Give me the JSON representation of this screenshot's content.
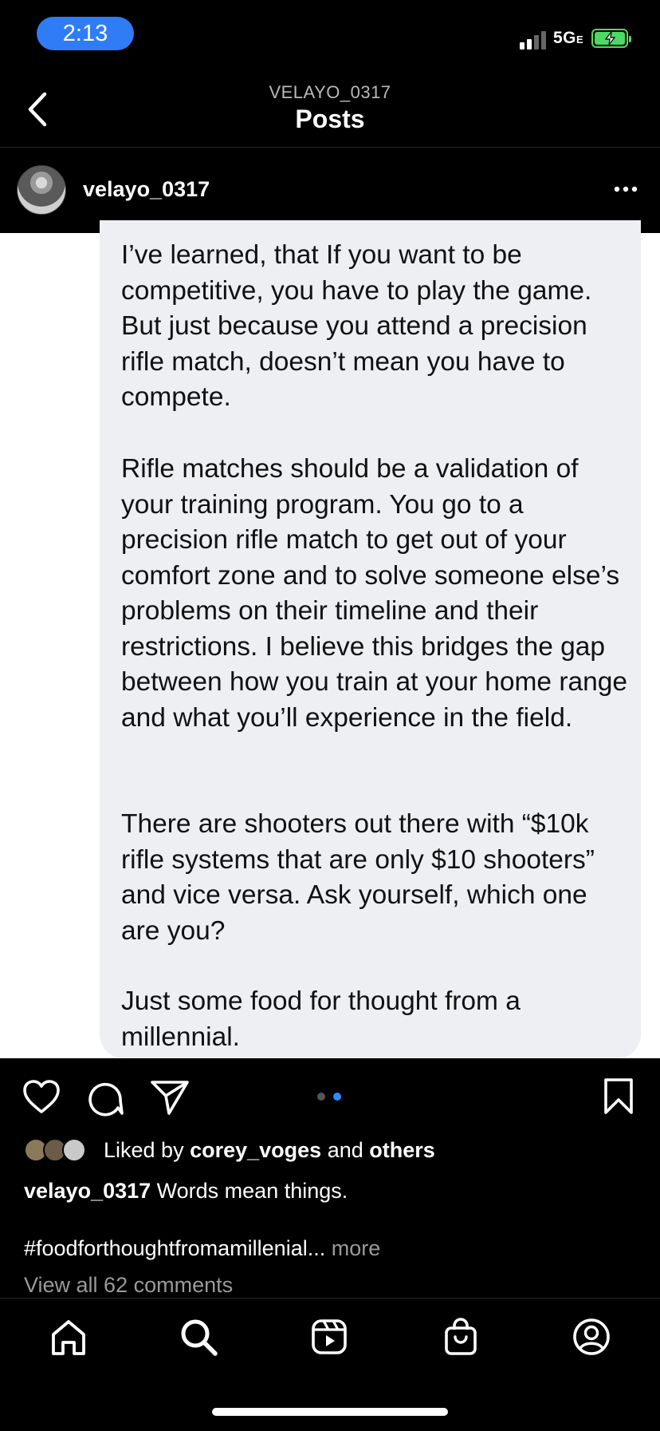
{
  "status_bar": {
    "time": "2:13",
    "network": "5G",
    "network_suffix": "E",
    "battery_color": "#4cd964",
    "time_pill_color": "#2f7cf6"
  },
  "header": {
    "subtitle": "VELAYO_0317",
    "title": "Posts"
  },
  "post": {
    "author": "velayo_0317",
    "paragraphs": [
      "I’ve learned, that If you want to be competitive, you have to play the game. But just because you attend a precision rifle match, doesn’t mean you have to compete.",
      "Rifle matches should be a validation of your training program. You go to a precision rifle match to get out of your comfort zone and to solve someone else’s problems on their timeline and their restrictions. I believe this bridges the gap between how you train at your home range and what you’ll experience in the field.",
      "There are shooters out there with “$10k rifle systems that are only $10 shooters” and vice versa. Ask yourself, which one are you?",
      "Just some food for thought from a millennial."
    ],
    "carousel": {
      "count": 2,
      "active_index": 1
    }
  },
  "engagement": {
    "liked_prefix": "Liked by",
    "liked_user": "corey_voges",
    "liked_and": "and",
    "liked_others": "others",
    "caption_user": "velayo_0317",
    "caption_text": "Words mean things.",
    "hashtag": "#foodforthoughtfromamillenial...",
    "more_label": "more",
    "view_comments": "View all 62 comments"
  },
  "tab_bar": {
    "items": [
      "home-icon",
      "search-icon",
      "reels-icon",
      "shop-icon",
      "profile-icon"
    ]
  }
}
